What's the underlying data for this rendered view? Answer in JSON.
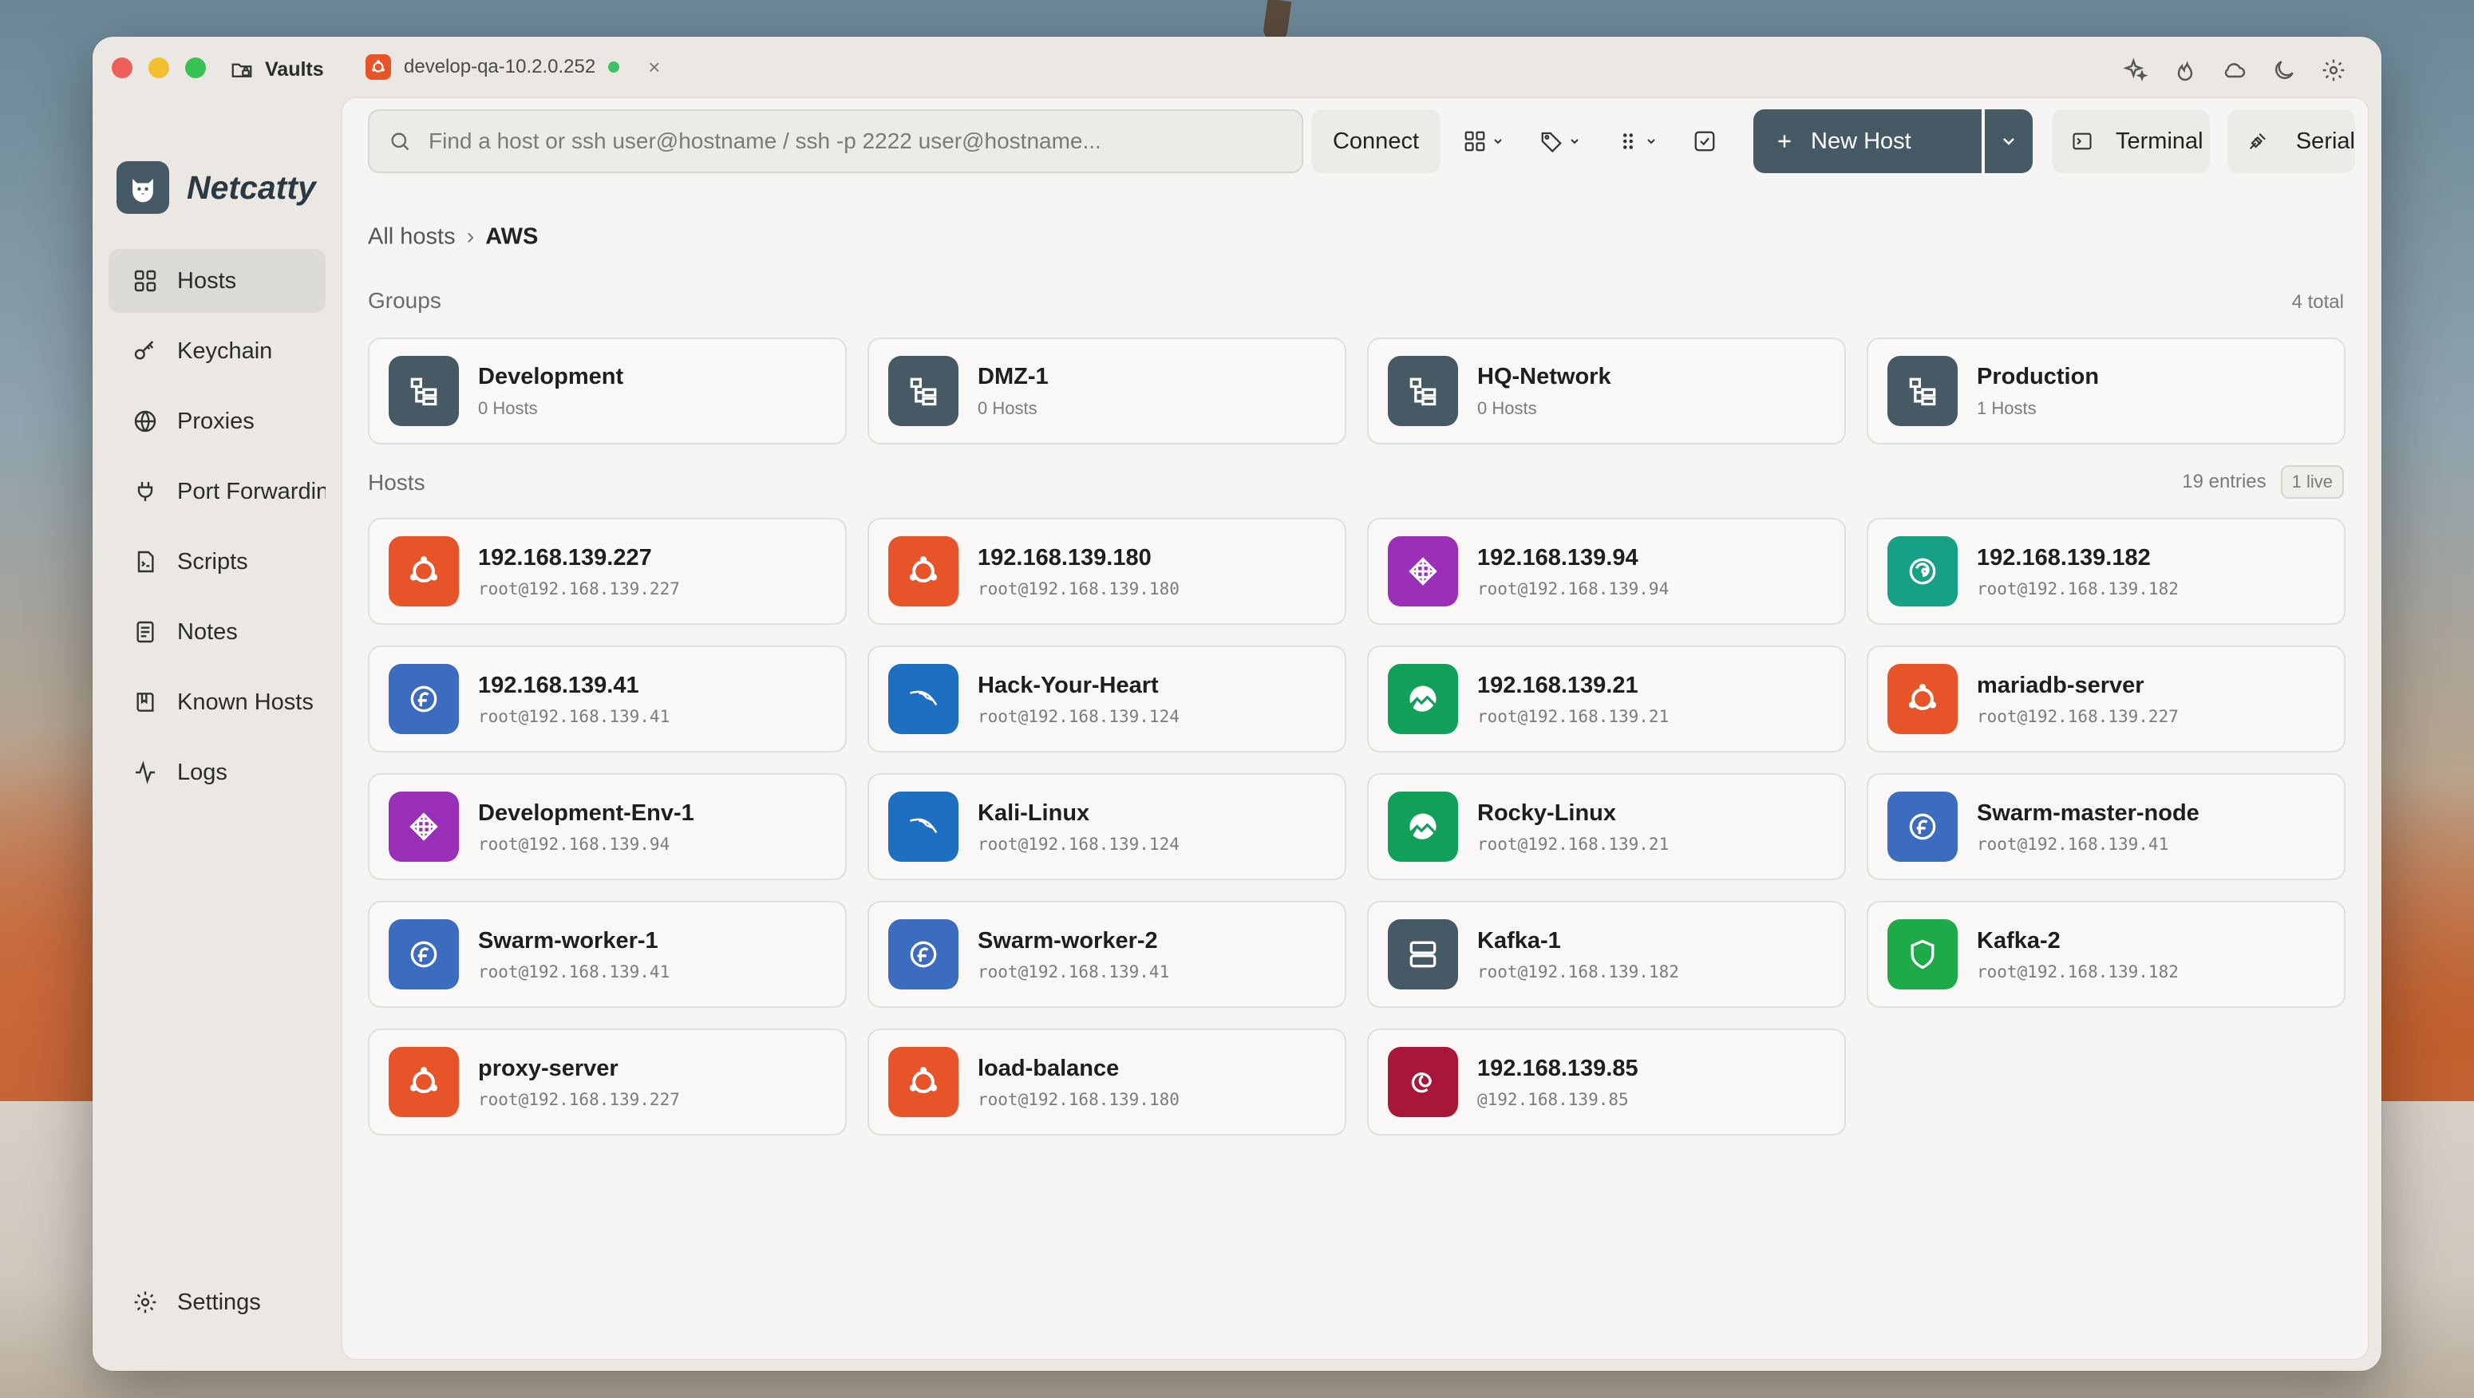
{
  "titlebar": {
    "vaults_label": "Vaults",
    "tab_label": "develop-qa-10.2.0.252",
    "tab_status_color": "#3fbf67",
    "tab_close": "×"
  },
  "brand": {
    "name": "Netcatty"
  },
  "nav": {
    "items": [
      {
        "label": "Hosts",
        "icon": "grid-icon"
      },
      {
        "label": "Keychain",
        "icon": "key-icon"
      },
      {
        "label": "Proxies",
        "icon": "globe-icon"
      },
      {
        "label": "Port Forwarding",
        "icon": "plug-icon"
      },
      {
        "label": "Scripts",
        "icon": "script-icon"
      },
      {
        "label": "Notes",
        "icon": "notes-icon"
      },
      {
        "label": "Known Hosts",
        "icon": "book-icon"
      },
      {
        "label": "Logs",
        "icon": "activity-icon"
      }
    ],
    "settings_label": "Settings"
  },
  "toolbar": {
    "search_placeholder": "Find a host or ssh user@hostname / ssh -p 2222 user@hostname...",
    "connect_label": "Connect",
    "new_host_label": "New Host",
    "terminal_label": "Terminal",
    "serial_label": "Serial"
  },
  "breadcrumb": {
    "root": "All hosts",
    "separator": "›",
    "current": "AWS"
  },
  "groups": {
    "label": "Groups",
    "count_label": "4 total",
    "items": [
      {
        "name": "Development",
        "hosts": "0 Hosts"
      },
      {
        "name": "DMZ-1",
        "hosts": "0 Hosts"
      },
      {
        "name": "HQ-Network",
        "hosts": "0 Hosts"
      },
      {
        "name": "Production",
        "hosts": "1 Hosts"
      }
    ]
  },
  "hosts": {
    "label": "Hosts",
    "count_label": "19 entries",
    "live_label": "1 live",
    "items": [
      {
        "name": "192.168.139.227",
        "address": "root@192.168.139.227",
        "os": "ubuntu",
        "color": "#e8542a"
      },
      {
        "name": "192.168.139.180",
        "address": "root@192.168.139.180",
        "os": "ubuntu",
        "color": "#e8542a"
      },
      {
        "name": "192.168.139.94",
        "address": "root@192.168.139.94",
        "os": "centos",
        "color": "#9b30b8"
      },
      {
        "name": "192.168.139.182",
        "address": "root@192.168.139.182",
        "os": "opensuse",
        "color": "#16a085"
      },
      {
        "name": "192.168.139.41",
        "address": "root@192.168.139.41",
        "os": "fedora",
        "color": "#3b6cc0"
      },
      {
        "name": "Hack-Your-Heart",
        "address": "root@192.168.139.124",
        "os": "kali",
        "color": "#1e6fc2"
      },
      {
        "name": "192.168.139.21",
        "address": "root@192.168.139.21",
        "os": "rocky",
        "color": "#10a05a"
      },
      {
        "name": "mariadb-server",
        "address": "root@192.168.139.227",
        "os": "ubuntu",
        "color": "#e8542a"
      },
      {
        "name": "Development-Env-1",
        "address": "root@192.168.139.94",
        "os": "centos",
        "color": "#9b30b8"
      },
      {
        "name": "Kali-Linux",
        "address": "root@192.168.139.124",
        "os": "kali",
        "color": "#1e6fc2"
      },
      {
        "name": "Rocky-Linux",
        "address": "root@192.168.139.21",
        "os": "rocky",
        "color": "#10a05a"
      },
      {
        "name": "Swarm-master-node",
        "address": "root@192.168.139.41",
        "os": "fedora",
        "color": "#3b6cc0"
      },
      {
        "name": "Swarm-worker-1",
        "address": "root@192.168.139.41",
        "os": "fedora",
        "color": "#3b6cc0"
      },
      {
        "name": "Swarm-worker-2",
        "address": "root@192.168.139.41",
        "os": "fedora",
        "color": "#3b6cc0"
      },
      {
        "name": "Kafka-1",
        "address": "root@192.168.139.182",
        "os": "server",
        "color": "#455a64"
      },
      {
        "name": "Kafka-2",
        "address": "root@192.168.139.182",
        "os": "shield",
        "color": "#1faa4a"
      },
      {
        "name": "proxy-server",
        "address": "root@192.168.139.227",
        "os": "ubuntu",
        "color": "#e8542a"
      },
      {
        "name": "load-balance",
        "address": "root@192.168.139.180",
        "os": "ubuntu",
        "color": "#e8542a"
      },
      {
        "name": "192.168.139.85",
        "address": "@192.168.139.85",
        "os": "debian",
        "color": "#a8163a"
      }
    ]
  },
  "colors": {
    "accent": "#455a64",
    "group_badge": "#455a64"
  }
}
